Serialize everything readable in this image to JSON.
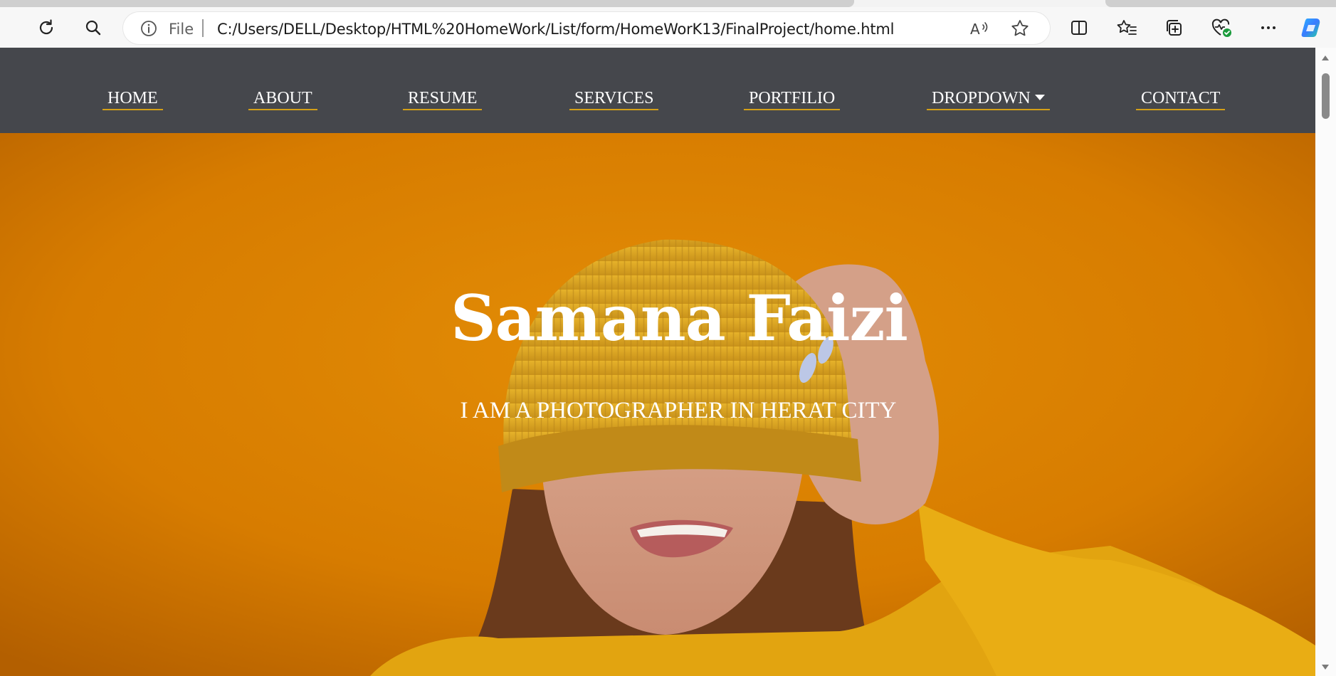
{
  "browser": {
    "address_file_label": "File",
    "address_url": "C:/Users/DELL/Desktop/HTML%20HomeWork/List/form/HomeWorK13/FinalProject/home.html",
    "icons": [
      "refresh-icon",
      "search-icon",
      "info-icon",
      "read-aloud-icon",
      "favorite-star-icon",
      "split-screen-icon",
      "favorites-icon",
      "collections-icon",
      "browser-essentials-icon",
      "more-icon",
      "copilot-icon"
    ]
  },
  "nav": {
    "items": [
      {
        "label": "HOME"
      },
      {
        "label": "ABOUT"
      },
      {
        "label": "RESUME"
      },
      {
        "label": "SERVICES"
      },
      {
        "label": "PORTFILIO"
      },
      {
        "label": "DROPDOWN"
      },
      {
        "label": "CONTACT"
      }
    ],
    "background": "#45474c",
    "underline_color": "#d4a017"
  },
  "hero": {
    "name": "Samana Faizi",
    "tagline": "I AM A PHOTOGRAPHER IN HERAT CITY",
    "background_color": "#d87e00"
  }
}
